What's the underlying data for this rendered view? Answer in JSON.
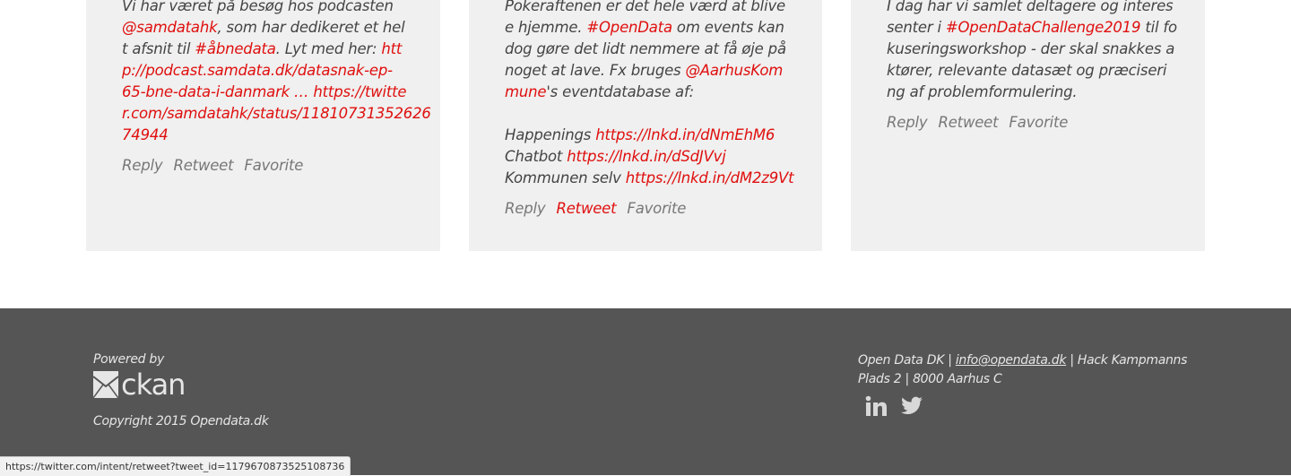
{
  "tweets": [
    {
      "lines": [
        [
          {
            "t": "Vi har været på besøg hos podcasten"
          }
        ],
        [
          {
            "t": "@samdatahk",
            "link": true
          },
          {
            "t": ", som har dedikeret et hel"
          }
        ],
        [
          {
            "t": "t afsnit til "
          },
          {
            "t": "#åbnedata",
            "link": true
          },
          {
            "t": ". Lyt med her: "
          },
          {
            "t": "htt",
            "link": true
          }
        ],
        [
          {
            "t": "p://podcast.samdata.dk/datasnak-ep-",
            "link": true
          }
        ],
        [
          {
            "t": "65-bne-data-i-danmark … https://twitte",
            "link": true
          }
        ],
        [
          {
            "t": "r.com/samdatahk/status/11810731352626",
            "link": true
          }
        ],
        [
          {
            "t": "74944",
            "link": true
          }
        ]
      ],
      "actions": [
        {
          "label": "Reply"
        },
        {
          "label": "Retweet"
        },
        {
          "label": "Favorite"
        }
      ]
    },
    {
      "lines": [
        [
          {
            "t": "Pokeraftenen er det hele værd at blive"
          }
        ],
        [
          {
            "t": "e hjemme. "
          },
          {
            "t": "#OpenData",
            "link": true
          },
          {
            "t": " om events kan"
          }
        ],
        [
          {
            "t": "dog gøre det lidt nemmere at få øje på"
          }
        ],
        [
          {
            "t": "noget at lave. Fx bruges "
          },
          {
            "t": "@AarhusKom",
            "link": true
          }
        ],
        [
          {
            "t": "mune",
            "link": true
          },
          {
            "t": "'s eventdatabase af:"
          }
        ],
        [
          {
            "t": ""
          }
        ],
        [
          {
            "t": "Happenings "
          },
          {
            "t": "https://lnkd.in/dNmEhM6",
            "link": true
          }
        ],
        [
          {
            "t": "Chatbot "
          },
          {
            "t": "https://lnkd.in/dSdJVvj",
            "link": true
          }
        ],
        [
          {
            "t": "Kommunen selv "
          },
          {
            "t": "https://lnkd.in/dM2z9Vt",
            "link": true
          }
        ]
      ],
      "actions": [
        {
          "label": "Reply"
        },
        {
          "label": "Retweet",
          "active": true
        },
        {
          "label": "Favorite"
        }
      ]
    },
    {
      "lines": [
        [
          {
            "t": "I dag har vi samlet deltagere og interes"
          }
        ],
        [
          {
            "t": "senter i "
          },
          {
            "t": "#OpenDataChallenge2019",
            "link": true
          },
          {
            "t": " til fo"
          }
        ],
        [
          {
            "t": "kuseringsworkshop - der skal snakkes a"
          }
        ],
        [
          {
            "t": "ktører, relevante datasæt og præciseri"
          }
        ],
        [
          {
            "t": "ng af problemformulering."
          }
        ]
      ],
      "actions": [
        {
          "label": "Reply"
        },
        {
          "label": "Retweet"
        },
        {
          "label": "Favorite"
        }
      ]
    }
  ],
  "footer": {
    "powered_by": "Powered by",
    "logo_text": "ckan",
    "copyright": "Copyright 2015 Opendata.dk",
    "contact_prefix": "Open Data DK | ",
    "contact_email": "info@opendata.dk",
    "contact_suffix": " | Hack Kampmanns Plads 2 | 8000 Aarhus C",
    "social_icons": [
      "linkedin-icon",
      "twitter-icon"
    ]
  },
  "status_url": "https://twitter.com/intent/retweet?tweet_id=1179670873525108736",
  "colors": {
    "link": "#e00f0f",
    "card_bg": "#eff0ef",
    "footer_bg": "#555555"
  }
}
